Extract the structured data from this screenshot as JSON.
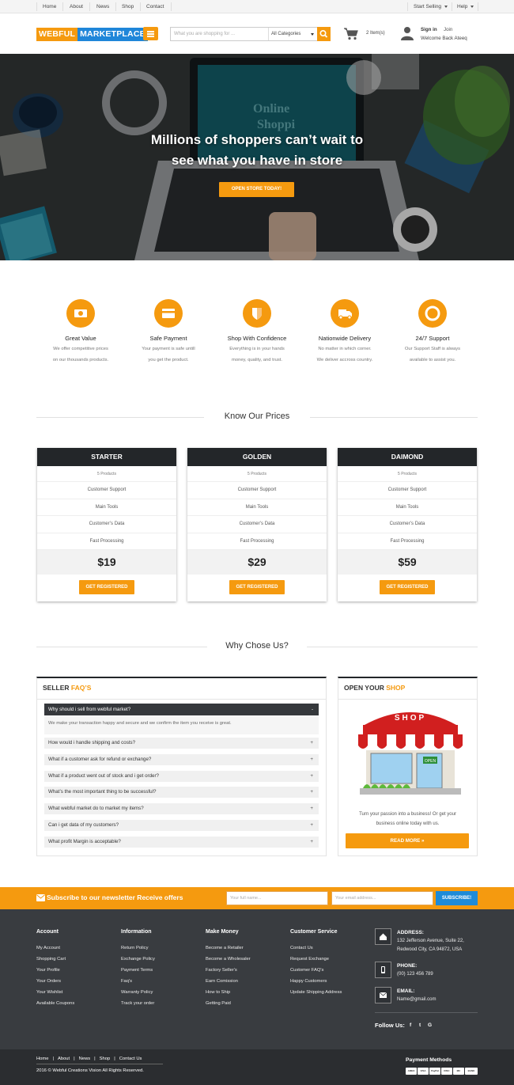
{
  "topbar": {
    "links": [
      "Home",
      "About",
      "News",
      "Shop",
      "Contact"
    ],
    "start_selling": "Start Selling",
    "help": "Help"
  },
  "header": {
    "logo_part1": "WEBFUL",
    "logo_part2": "MARKETPLACE",
    "search_placeholder": "What you are shopping for ...",
    "category": "All Categories",
    "cart_items": "2 Item(s)",
    "sign_in": "Sign in",
    "join": "Join",
    "welcome": "Welcome Back Ateeq"
  },
  "hero": {
    "headline_line1": "Millions of shoppers can’t wait to",
    "headline_line2": "see what you have in store",
    "cta": "OPEN STORE TODAY!"
  },
  "features": [
    {
      "title": "Great Value",
      "line1": "We offer competitive prices",
      "line2": "on our thousands products.",
      "icon": "money-icon"
    },
    {
      "title": "Safe Payment",
      "line1": "Your payment is safe untill",
      "line2": "you get the product.",
      "icon": "credit-card-icon"
    },
    {
      "title": "Shop With Confidence",
      "line1": "Everything is in your hands",
      "line2": "money, quality, and trust.",
      "icon": "shield-icon"
    },
    {
      "title": "Nationwide Delivery",
      "line1": "No matter in which corner.",
      "line2": "We deliver accross country.",
      "icon": "truck-icon"
    },
    {
      "title": "24/7 Support",
      "line1": "Our Support Staff is always",
      "line2": "available to assist you.",
      "icon": "lifebuoy-icon"
    }
  ],
  "prices": {
    "title": "Know Our Prices",
    "plans": [
      {
        "name": "STARTER",
        "products": "5 Products",
        "f1": "Customer Support",
        "f2": "Main Tools",
        "f3": "Customer’s Data",
        "f4": "Fast Processing",
        "price": "$19",
        "cta": "GET REGISTERED"
      },
      {
        "name": "GOLDEN",
        "products": "5 Products",
        "f1": "Customer Support",
        "f2": "Main Tools",
        "f3": "Customer’s Data",
        "f4": "Fast Processing",
        "price": "$29",
        "cta": "GET REGISTERED"
      },
      {
        "name": "DAIMOND",
        "products": "5 Products",
        "f1": "Customer Support",
        "f2": "Main Tools",
        "f3": "Customer’s Data",
        "f4": "Fast Processing",
        "price": "$59",
        "cta": "GET REGISTERED"
      }
    ]
  },
  "why": {
    "title": "Why Chose Us?"
  },
  "faq": {
    "title_a": "SELLER",
    "title_b": "FAQ’S",
    "open_q": "Why should i sell from webful market?",
    "open_a": "We make your transaction happy and secure and we confirm the item you receive is great.",
    "questions": [
      "How would i handle shipping and costs?",
      "What if a customer ask for refund or exchange?",
      "What if a product went out of stock and i get order?",
      "What’s the most important thing to be successful?",
      "What webful market do to market my items?",
      "Can i get data of my customers?",
      "What profit Margin is acceptable?"
    ],
    "minus": "-",
    "plus": "+"
  },
  "shop": {
    "title_a": "OPEN YOUR",
    "title_b": "SHOP",
    "awning": "SHOP",
    "sign": "OPEN",
    "text1": "Turn your passion into a business! Or get your",
    "text2": "business online today with us.",
    "cta": "READ MORE »"
  },
  "newsletter": {
    "title": "Subscribe to our newsletter Receive offers",
    "name_ph": "Your full name...",
    "email_ph": "Your email address...",
    "button": "SUBSCRIBE!"
  },
  "footer": {
    "account": {
      "title": "Account",
      "items": [
        "My Account",
        "Shopping Cart",
        "Your Profile",
        "Your Orders",
        "Your Wishlist",
        "Available Coupons"
      ]
    },
    "information": {
      "title": "Information",
      "items": [
        "Return Policy",
        "Exchange Policy",
        "Payment Terms",
        "Faq's",
        "Warranty Policy",
        "Track your order"
      ]
    },
    "make_money": {
      "title": "Make Money",
      "items": [
        "Become a Retailer",
        "Become a Wholesaler",
        "Factory Seller's",
        "Earn Comission",
        "How to Ship",
        "Getting Paid"
      ]
    },
    "service": {
      "title": "Customer Service",
      "items": [
        "Contact Us",
        "Request Exchange",
        "Customer FAQ's",
        "Happy Customers",
        "Update Shipping Address"
      ]
    },
    "address_label": "ADDRESS:",
    "address_line1": "132 Jefferson Avenue, Suite 22,",
    "address_line2": "Redwood City, CA 94872, USA",
    "phone_label": "PHONE:",
    "phone": "(00) 123 456 789",
    "email_label": "EMAIL:",
    "email": "Name@gmail.com",
    "follow": "Follow Us:",
    "social": [
      "f",
      "t",
      "G"
    ]
  },
  "bottom": {
    "links": [
      "Home",
      "About",
      "News",
      "Shop",
      "Contact Us"
    ],
    "copyright": "2016 © Webful Creations Vision All Rights Reserved.",
    "payment_title": "Payment Methods",
    "payments": [
      "AMEX",
      "VISA",
      "PayPal",
      "DISC",
      "MC",
      "BANK"
    ]
  },
  "colors": {
    "accent": "#f59a0f",
    "blue": "#1f86d9",
    "dark": "#393c40"
  }
}
